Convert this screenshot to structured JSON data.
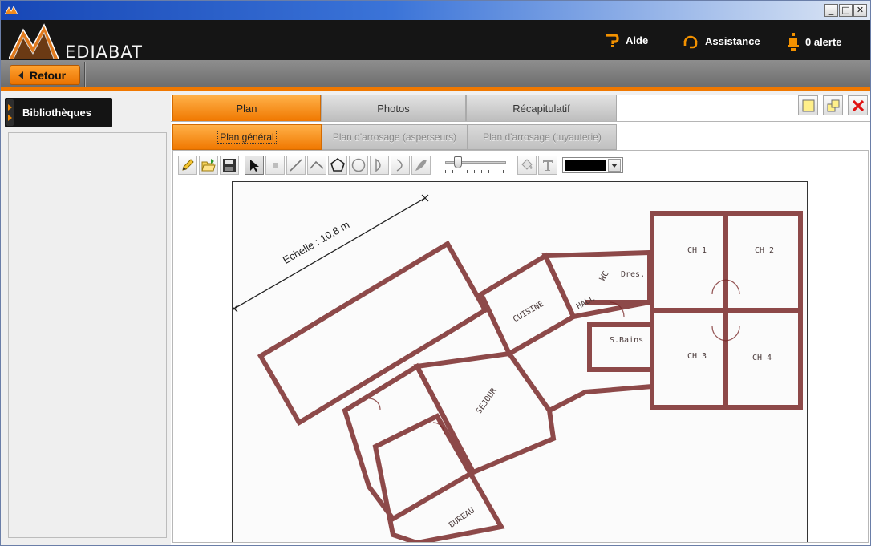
{
  "header": {
    "logo_text": "EDIABAT",
    "aide_label": "Aide",
    "assistance_label": "Assistance",
    "alerte_label": "0 alerte"
  },
  "window": {
    "minimize": "_",
    "maximize": "□",
    "close": "✕"
  },
  "nav": {
    "retour_label": "Retour"
  },
  "left": {
    "bibliotheques_label": "Bibliothèques"
  },
  "tabs": [
    {
      "label": "Plan",
      "active": true
    },
    {
      "label": "Photos",
      "active": false
    },
    {
      "label": "Récapitulatif",
      "active": false
    }
  ],
  "subtabs": [
    {
      "label": "Plan général",
      "active": true
    },
    {
      "label": "Plan d'arrosage (asperseurs)",
      "active": false
    },
    {
      "label": "Plan d'arrosage (tuyauterie)",
      "active": false
    }
  ],
  "toolbar": {
    "tools": [
      "pencil-icon",
      "open-folder-icon",
      "save-icon",
      "select-arrow-icon",
      "rectangle-icon",
      "line-icon",
      "polyline-icon",
      "polygon-icon",
      "circle-icon",
      "arc-icon",
      "arc-right-icon",
      "shade-icon",
      "fill-bucket-icon",
      "text-icon"
    ],
    "selected_color": "#000000",
    "slider_value": 0.15
  },
  "plan": {
    "scale_label": "Echelle : 10,8 m",
    "rooms": {
      "ch1": "CH 1",
      "ch2": "CH 2",
      "ch3": "CH 3",
      "ch4": "CH 4",
      "cuisine": "CUISINE",
      "hall": "HALL",
      "wc": "WC",
      "dres": "Dres.",
      "sbains": "S.Bains",
      "sejour": "SEJOUR",
      "bureau": "BUREAU"
    }
  },
  "colors": {
    "accent": "#f07800",
    "header_bg": "#151515",
    "wall": "#7a2a2a"
  }
}
